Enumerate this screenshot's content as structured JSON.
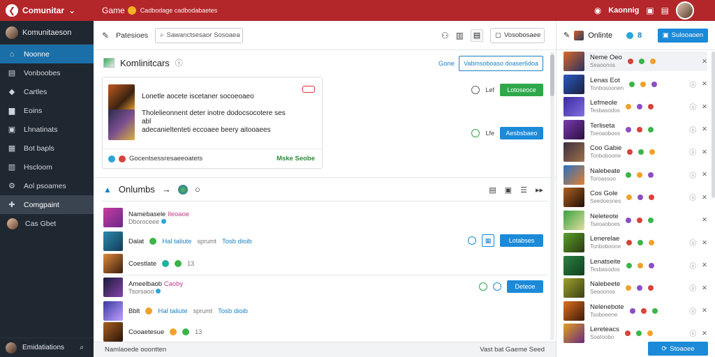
{
  "topbar": {
    "brand": "Comunitar",
    "game": "Game",
    "subtitle": "Cadbodage cadbodabaetes",
    "user_label": "Kaonnig"
  },
  "sidebar": {
    "header": "Komunitaeson",
    "items": [
      {
        "label": "Noonne",
        "icon": "home-icon"
      },
      {
        "label": "Vonboobes",
        "icon": "list-icon"
      },
      {
        "label": "Cartles",
        "icon": "tag-icon"
      },
      {
        "label": "Eoins",
        "icon": "briefcase-icon"
      },
      {
        "label": "Lhnatinats",
        "icon": "document-icon"
      },
      {
        "label": "Bot bapls",
        "icon": "robot-icon"
      },
      {
        "label": "Hscloom",
        "icon": "calendar-icon"
      },
      {
        "label": "Aol psoames",
        "icon": "gear-icon"
      },
      {
        "label": "Comgpaint",
        "icon": "puzzle-icon"
      },
      {
        "label": "Cas Gbet",
        "icon": "avatar"
      }
    ],
    "footer": "Emidatiations"
  },
  "toolbar": {
    "tab": "Patesioes",
    "search_placeholder": "Sawanctsesaor Sosoaea",
    "select_label": "Vosobosaee"
  },
  "section1": {
    "title": "Komlinitcars",
    "action_link": "Gone",
    "action_button": "Vabmsoboaso doaser6doa",
    "card": {
      "notif1": "Lonetle aocete iscetaner socoeoaeo",
      "notif2_line1": "Tholelieonnent deter inotre dodocsocotere ses",
      "notif2_line2": "abl",
      "notif2_line3": "adecanieltenteti eccoaee beery aitooaees",
      "footer_text": "Gocentsessresaeeoatets",
      "footer_more": "Mske Seobe"
    },
    "row1": {
      "count": "Lef",
      "button": "Lotoseoce"
    },
    "row2": {
      "count": "Lfe",
      "button": "Aesbsbaeo"
    }
  },
  "section2": {
    "title": "Onlumbs",
    "items": [
      {
        "title": "Namebasele",
        "tag": "Ileoaoe",
        "sub": "Dboroceee"
      },
      {
        "title": "Dalat",
        "link1": "Hal taliute",
        "mid": "sprumt",
        "link2": "Tosb dioib",
        "button": "Lotabses"
      },
      {
        "title": "Coestlate",
        "sub": "13"
      },
      {
        "title": "Ameelbaob",
        "tag": "Caoby",
        "sub": "Tsorsaoo",
        "button": "Deteoe"
      },
      {
        "title": "Bblt",
        "link1": "Hal taliute",
        "mid": "sprumt",
        "link2": "Tosb dioib"
      },
      {
        "title": "Cooaetesue",
        "sub": "13"
      }
    ]
  },
  "statusbar": {
    "left": "Namlaoede ooontten",
    "right": "Vast bat  Gaeme Seed"
  },
  "rightpanel": {
    "title": "Onlinte",
    "count": "8",
    "button": "Sulooaoen",
    "rows": [
      {
        "name": "Neme Oeo",
        "sub": "Seaoonos"
      },
      {
        "name": "Lenas Eot",
        "sub": "Tonbosoonen"
      },
      {
        "name": "Lefmeole",
        "sub": "Tesbasodos"
      },
      {
        "name": "Terliseta",
        "sub": "Tseoaoboes"
      },
      {
        "name": "Coo Gabie",
        "sub": "Tonboboone"
      },
      {
        "name": "Nalebeate",
        "sub": "Toroassoo"
      },
      {
        "name": "Cos Gole",
        "sub": "Seedoesnes"
      },
      {
        "name": "Neleteote",
        "sub": "Tseoaoboes"
      },
      {
        "name": "Lenerelae",
        "sub": "Tonboboone"
      },
      {
        "name": "Lenatseite",
        "sub": "Tesbasodos"
      },
      {
        "name": "Nalebeete",
        "sub": "Seaoonos"
      },
      {
        "name": "Nelenebote",
        "sub": "Tsoboeene"
      },
      {
        "name": "Lereteacs",
        "sub": "Soatoobo"
      }
    ],
    "footer_button": "Stoaoee"
  },
  "colors": {
    "topbar": "#b3262a",
    "sidebar": "#1f2730",
    "active": "#1b6fa8",
    "accent": "#1b8ad8",
    "success": "#2ea84a"
  }
}
